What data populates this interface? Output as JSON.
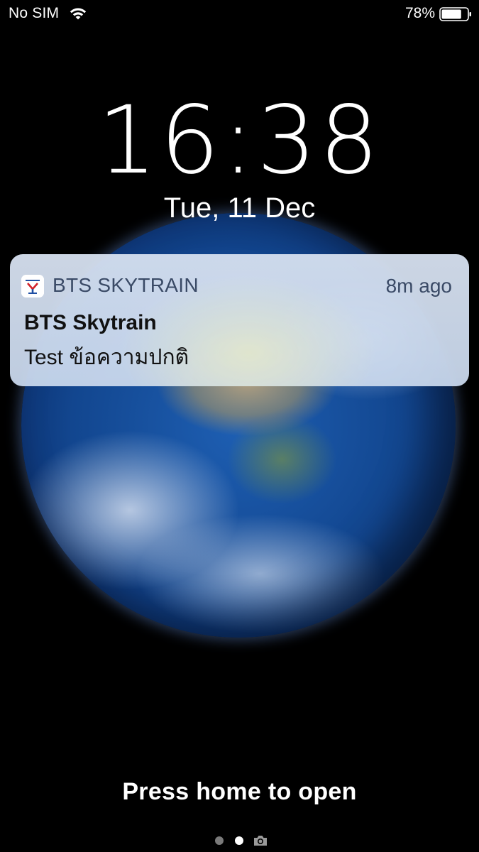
{
  "status_bar": {
    "carrier": "No SIM",
    "battery_percent": "78%",
    "battery_level": 0.78,
    "wifi_icon": "wifi-icon",
    "battery_icon": "battery-icon"
  },
  "lock_screen": {
    "time": "16:38",
    "date": "Tue, 11 Dec"
  },
  "notification": {
    "app_icon": "bts-app-icon",
    "app_name": "BTS SKYTRAIN",
    "time_ago": "8m ago",
    "title": "BTS Skytrain",
    "body": "Test ข้อความปกติ"
  },
  "footer": {
    "unlock_hint": "Press home to open",
    "page_dots": 2,
    "active_page": 2,
    "camera_icon": "camera-icon"
  },
  "colors": {
    "background": "#000000",
    "notification_text": "#111111",
    "notification_header_text": "#3a4a66",
    "brand_red": "#d2232a",
    "brand_blue": "#1f4fa3"
  }
}
